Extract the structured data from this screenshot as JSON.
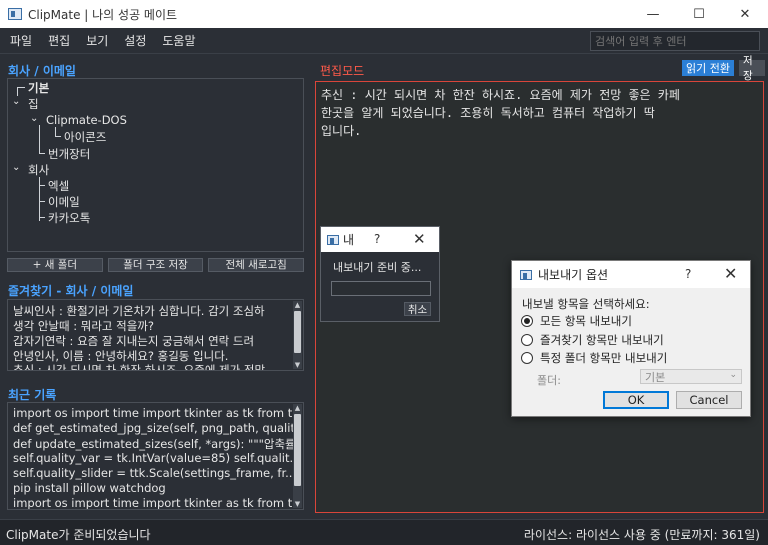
{
  "window": {
    "title": "ClipMate | 나의 성공 메이트",
    "controls": {
      "minimize": "—",
      "maximize": "☐",
      "close": "✕"
    }
  },
  "menu": {
    "items": [
      "파일",
      "편집",
      "보기",
      "설정",
      "도움말"
    ],
    "search_placeholder": "검색어 입력 후 엔터"
  },
  "tree": {
    "title": "회사 / 이메일",
    "items": [
      {
        "label": "기본",
        "glyph": "┣"
      },
      {
        "label": "집",
        "glyph": "⌄"
      },
      {
        "label": "Clipmate-DOS",
        "glyph": "⌄"
      },
      {
        "label": "아이콘즈"
      },
      {
        "label": "번개장터"
      },
      {
        "label": "회사",
        "glyph": "⌄"
      },
      {
        "label": "엑셀"
      },
      {
        "label": "이메일"
      },
      {
        "label": "카카오톡"
      }
    ]
  },
  "tree_buttons": {
    "new_folder": "+ 새 폴더",
    "save_structure": "폴더 구조 저장",
    "refresh_all": "전체 새로고침"
  },
  "favorites": {
    "title": "즐겨찾기 - 회사 / 이메일",
    "items": [
      "날씨인사 : 환절기라 기온차가 심합니다. 감기 조심하",
      "생각 안날때 : 뭐라고 적을까?",
      "갑자기연락 : 요즘 잘 지내는지 궁금해서 연락 드려",
      "안녕인사, 이름 : 안녕하세요? 홍길동 입니다.",
      "추신 : 시간 되시면 차 한잔 하시죠. 요즘에 제가 전망"
    ]
  },
  "recent": {
    "title": "최근 기록",
    "items": [
      "import os import time import tkinter as tk from tk",
      "def get_estimated_jpg_size(self, png_path, quality...",
      "def update_estimated_sizes(self, *args): \"\"\"압축률 변",
      "self.quality_var = tk.IntVar(value=85) self.qualit...",
      "self.quality_slider = ttk.Scale(settings_frame, fr...",
      "pip install pillow watchdog",
      "import os import time import tkinter as tk from tk"
    ]
  },
  "editor": {
    "mode_label": "편집모드",
    "read_toggle": "읽기 전환",
    "save": "저장",
    "lines": [
      "추신 : 시간 되시면 차 한잔 하시죠. 요즘에 제가 전망 좋은 카페",
      "한곳을 알게 되었습니다. 조용히 독서하고 컴퓨터 작업하기 딱",
      "입니다."
    ]
  },
  "status": {
    "left": "ClipMate가 준비되었습니다",
    "right": "라이선스: 라이선스 사용 중 (만료까지: 361일)"
  },
  "progress_dialog": {
    "title": "내",
    "help": "?",
    "close": "✕",
    "message": "내보내기 준비 중...",
    "progress": 0,
    "cancel": "취소"
  },
  "export_dialog": {
    "title": "내보내기 옵션",
    "help": "?",
    "close": "✕",
    "prompt": "내보낼 항목을 선택하세요:",
    "options": [
      "모든 항목 내보내기",
      "즐겨찾기 항목만 내보내기",
      "특정 폴더 항목만 내보내기"
    ],
    "selected": 0,
    "folder_label": "폴더:",
    "folder_value": "기본",
    "ok": "OK",
    "cancel": "Cancel"
  },
  "colors": {
    "accent_blue": "#4aa3ff",
    "edit_red": "#ff5a4a",
    "button_blue": "#2b7fd6"
  }
}
